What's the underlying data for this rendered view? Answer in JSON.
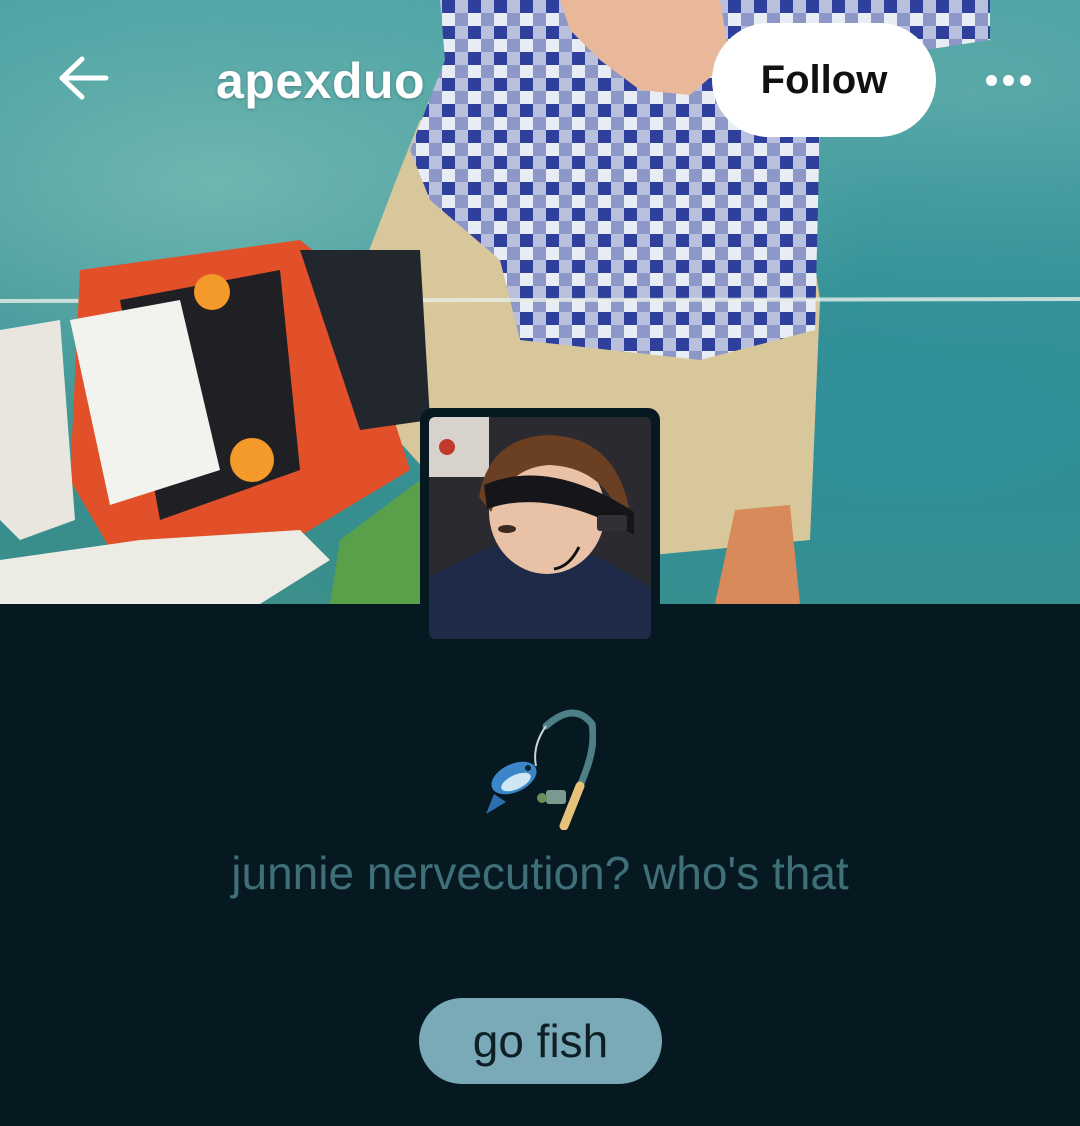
{
  "header": {
    "blog_name": "apexduo",
    "follow_label": "Follow",
    "back_icon": "arrow-left-icon",
    "more_icon": "ellipsis-icon"
  },
  "profile": {
    "description": "junnie nervecution? who's that",
    "emoji": "fishing-pole-emoji",
    "link_button_label": "go fish"
  },
  "colors": {
    "background": "#061820",
    "description_text": "#3f6f78",
    "link_button": "#7aaab8",
    "follow_button": "#ffffff"
  }
}
